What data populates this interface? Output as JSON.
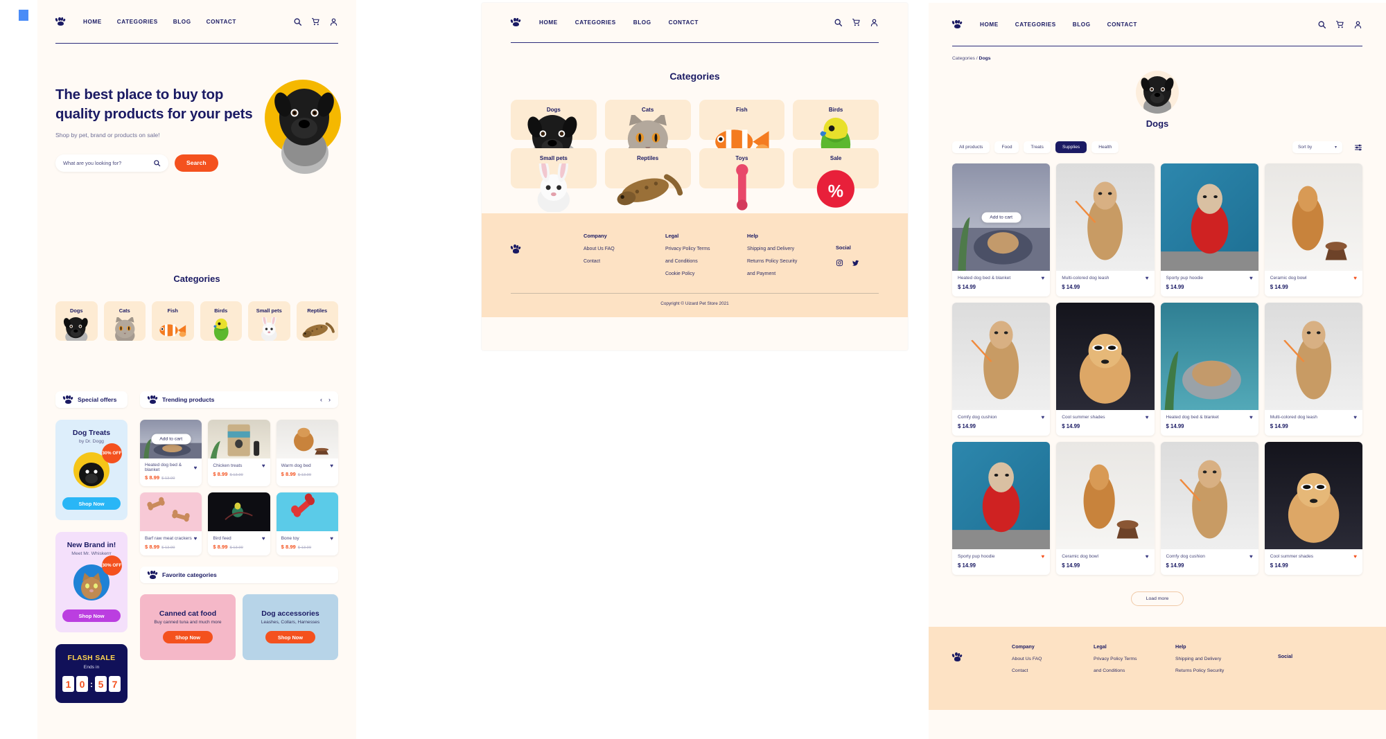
{
  "brand": {
    "logo_icon": "paw-icon",
    "name": "Uizard Pet Store"
  },
  "nav": {
    "items": [
      "HOME",
      "CATEGORIES",
      "BLOG",
      "CONTACT"
    ],
    "icons": [
      "search-icon",
      "cart-icon",
      "user-icon"
    ]
  },
  "left_panel": {
    "hero": {
      "title": "The best place to buy top quality products for your pets",
      "subtitle": "Shop by pet, brand or products on sale!",
      "search_placeholder": "What are you looking for?",
      "search_value": "",
      "search_button": "Search",
      "search_icon": "search-icon",
      "image_alt": "pug-photo"
    },
    "categories_title": "Categories",
    "categories": [
      {
        "label": "Dogs",
        "art": "dog"
      },
      {
        "label": "Cats",
        "art": "cat"
      },
      {
        "label": "Fish",
        "art": "fish"
      },
      {
        "label": "Birds",
        "art": "bird"
      },
      {
        "label": "Small pets",
        "art": "rabbit"
      },
      {
        "label": "Reptiles",
        "art": "reptile"
      }
    ],
    "special_offers_title": "Special offers",
    "trending_title": "Trending products",
    "favorite_title": "Favorite categories",
    "carousel_prev": "‹",
    "carousel_next": "›",
    "offers": [
      {
        "title": "Dog Treats",
        "subtitle": "by Dr. Dogg",
        "badge": "30% OFF",
        "button": "Shop Now",
        "theme": "blue"
      },
      {
        "title": "New Brand in!",
        "subtitle": "Meet Mr. Whiskerrr",
        "badge": "30% OFF",
        "button": "Shop Now",
        "theme": "pink"
      }
    ],
    "flash_sale": {
      "title": "FLASH SALE",
      "ends_label": "Ends in",
      "digits": [
        "1",
        "0",
        "5",
        "7"
      ],
      "separator": ":"
    },
    "trending_products": [
      {
        "name": "Heated dog bed & blanket",
        "price": "$ 8.99",
        "old_price": "$ 13.99",
        "fav": false,
        "overlay": "Add to cart",
        "art": "room"
      },
      {
        "name": "Chicken treats",
        "price": "$ 8.99",
        "old_price": "$ 13.99",
        "fav": false,
        "overlay": "",
        "art": "bag"
      },
      {
        "name": "Warm dog bed",
        "price": "$ 8.99",
        "old_price": "$ 13.99",
        "fav": false,
        "overlay": "",
        "art": "bowlbg"
      },
      {
        "name": "Barf raw meat crackers",
        "price": "$ 8.99",
        "old_price": "$ 13.99",
        "fav": false,
        "overlay": "",
        "art": "pinkbg"
      },
      {
        "name": "Bird feed",
        "price": "$ 8.99",
        "old_price": "$ 13.99",
        "fav": false,
        "overlay": "",
        "art": "dark"
      },
      {
        "name": "Bone toy",
        "price": "$ 8.99",
        "old_price": "$ 13.99",
        "fav": false,
        "overlay": "",
        "art": "aqua"
      }
    ],
    "favorite_banners": [
      {
        "title": "Canned cat food",
        "subtitle": "Buy canned tuna and much more",
        "button": "Shop Now",
        "theme": "pink"
      },
      {
        "title": "Dog accessories",
        "subtitle": "Leashes, Collars, Harnesses",
        "button": "Shop Now",
        "theme": "blue"
      }
    ]
  },
  "mid_panel": {
    "title": "Categories",
    "categories": [
      {
        "label": "Dogs",
        "art": "dog"
      },
      {
        "label": "Cats",
        "art": "cat"
      },
      {
        "label": "Fish",
        "art": "fish"
      },
      {
        "label": "Birds",
        "art": "bird"
      },
      {
        "label": "Small pets",
        "art": "rabbit"
      },
      {
        "label": "Reptiles",
        "art": "reptile"
      },
      {
        "label": "Toys",
        "art": "toy"
      },
      {
        "label": "Sale",
        "art": "sale"
      }
    ],
    "footer": {
      "columns": [
        {
          "heading": "Company",
          "items": [
            "About Us FAQ",
            "Contact"
          ]
        },
        {
          "heading": "Legal",
          "items": [
            "Privacy Policy Terms",
            "and Conditions",
            "Cookie Policy"
          ]
        },
        {
          "heading": "Help",
          "items": [
            "Shipping and Delivery",
            "Returns Policy Security",
            "and Payment"
          ]
        }
      ],
      "social_heading": "Social",
      "social_icons": [
        "instagram-icon",
        "twitter-icon"
      ],
      "copyright": "Copyright © Uizard Pet Store 2021"
    }
  },
  "right_panel": {
    "breadcrumb_parent": "Categories",
    "breadcrumb_sep": "/",
    "breadcrumb_current": "Dogs",
    "category_name": "Dogs",
    "filters": [
      "All products",
      "Food",
      "Treats",
      "Supplies",
      "Health"
    ],
    "active_filter": "Supplies",
    "sort_label": "Sort by",
    "sort_caret": "▾",
    "filter_icon": "sliders-icon",
    "load_more": "Load more",
    "products": [
      {
        "name": "Heated dog bed & blanket",
        "price": "$ 14.99",
        "fav": false,
        "overlay": "Add to cart",
        "art": "room"
      },
      {
        "name": "Multi-colored dog leash",
        "price": "$ 14.99",
        "fav": false,
        "overlay": "",
        "art": "grey"
      },
      {
        "name": "Sporty pup hoodie",
        "price": "$ 14.99",
        "fav": false,
        "overlay": "",
        "art": "blue-wall"
      },
      {
        "name": "Ceramic dog bowl",
        "price": "$ 14.99",
        "fav": true,
        "overlay": "",
        "art": "bowlbg"
      },
      {
        "name": "Comfy dog cushion",
        "price": "$ 14.99",
        "fav": false,
        "overlay": "",
        "art": "grey"
      },
      {
        "name": "Cool summer shades",
        "price": "$ 14.99",
        "fav": false,
        "overlay": "",
        "art": "vend"
      },
      {
        "name": "Heated dog bed & blanket",
        "price": "$ 14.99",
        "fav": false,
        "overlay": "",
        "art": "teal"
      },
      {
        "name": "Multi-colored dog leash",
        "price": "$ 14.99",
        "fav": false,
        "overlay": "",
        "art": "grey"
      },
      {
        "name": "Sporty pup hoodie",
        "price": "$ 14.99",
        "fav": true,
        "overlay": "",
        "art": "blue-wall"
      },
      {
        "name": "Ceramic dog bowl",
        "price": "$ 14.99",
        "fav": false,
        "overlay": "",
        "art": "bowlbg"
      },
      {
        "name": "Comfy dog cushion",
        "price": "$ 14.99",
        "fav": false,
        "overlay": "",
        "art": "grey"
      },
      {
        "name": "Cool summer shades",
        "price": "$ 14.99",
        "fav": true,
        "overlay": "",
        "art": "vend"
      }
    ],
    "footer": {
      "columns": [
        {
          "heading": "Company",
          "items": [
            "About Us FAQ",
            "Contact"
          ]
        },
        {
          "heading": "Legal",
          "items": [
            "Privacy Policy Terms",
            "and Conditions"
          ]
        },
        {
          "heading": "Help",
          "items": [
            "Shipping and Delivery",
            "Returns Policy Security"
          ]
        }
      ],
      "social_heading": "Social"
    }
  },
  "colors": {
    "brand_navy": "#1a1a63",
    "accent_orange": "#f4511e",
    "page_cream": "#fffaf5",
    "card_peach": "#fdebd3",
    "footer_peach": "#fde2c4"
  }
}
